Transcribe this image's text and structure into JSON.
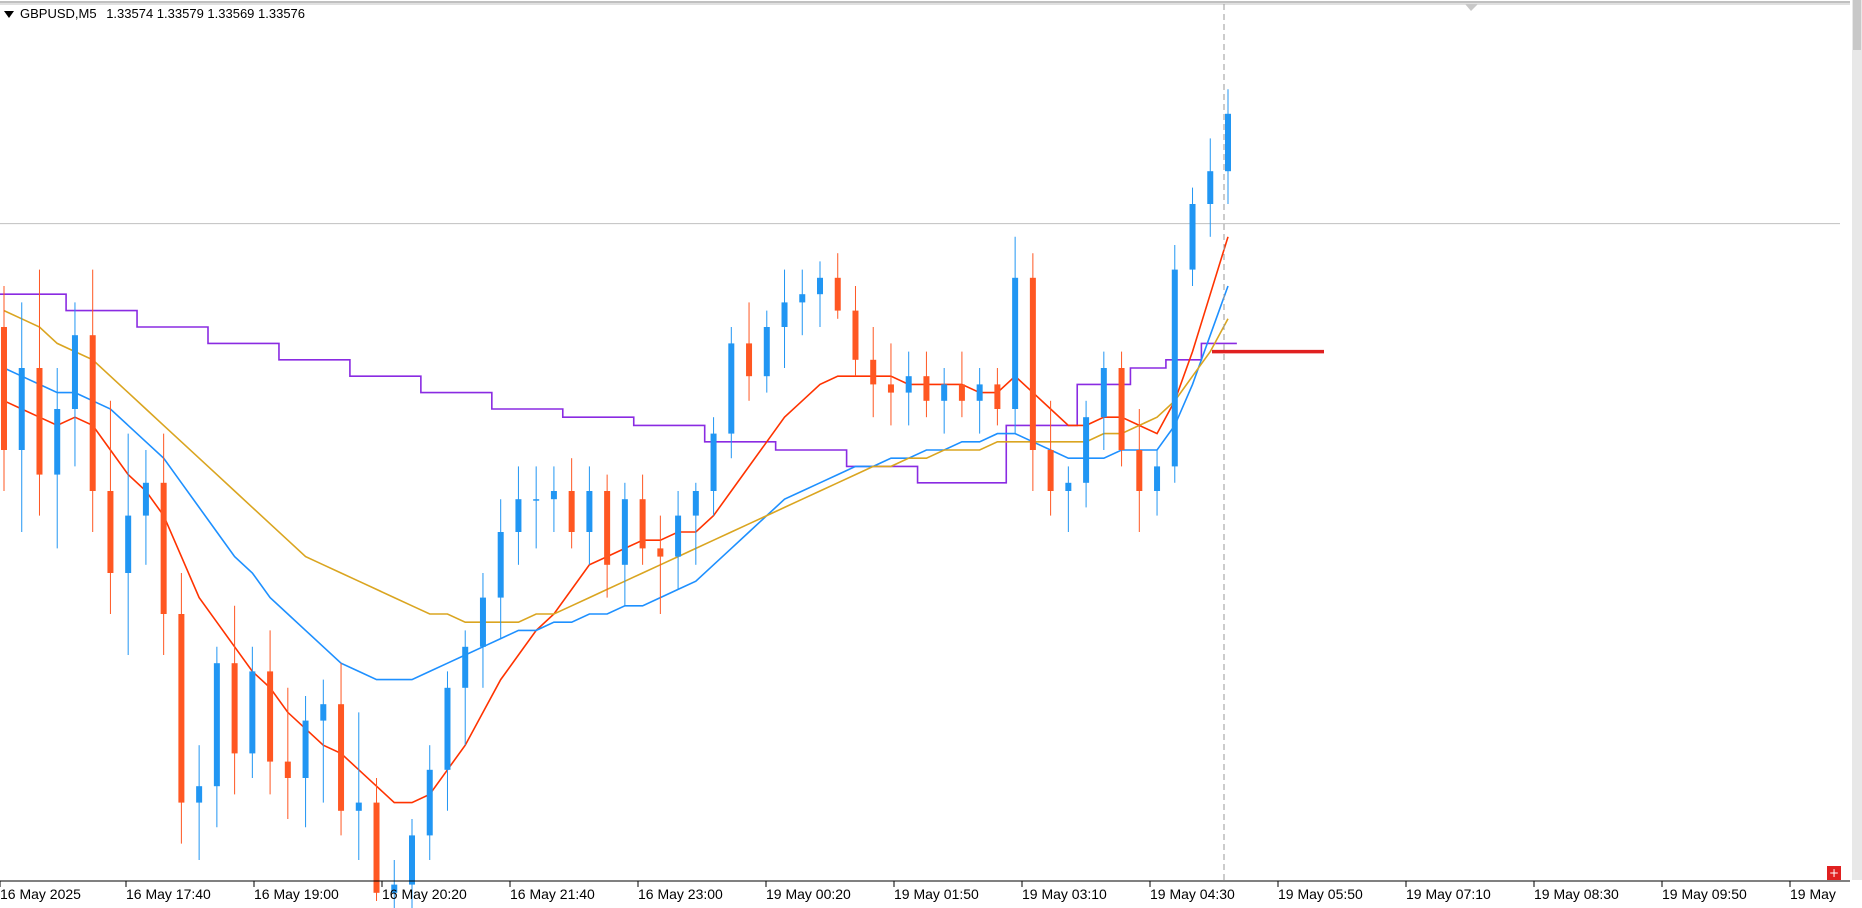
{
  "header": {
    "symbol": "GBPUSD,M5",
    "quotes": "1.33574 1.33579 1.33569 1.33576"
  },
  "colors": {
    "bull": "#2196f3",
    "bear": "#ff5722",
    "wick": "#000000",
    "ma_fast": "#ff3300",
    "ma_mid": "#1e90ff",
    "ma_slow": "#daa520",
    "stop_line": "#8a2be2",
    "level_marker": "#e02020",
    "grid": "#c0c0c0"
  },
  "icons": {
    "header_menu": "triangle-down-icon",
    "corner": "plus-icon",
    "top_marker": "chevron-down-icon"
  },
  "corner_button": "+",
  "chart_data": {
    "type": "candlestick",
    "symbol": "GBPUSD",
    "timeframe": "M5",
    "last_quote": {
      "open": 1.33574,
      "high": 1.33579,
      "low": 1.33569,
      "close": 1.33576
    },
    "x_labels": [
      "16 May 2025",
      "16 May 17:40",
      "16 May 19:00",
      "16 May 20:20",
      "16 May 21:40",
      "16 May 23:00",
      "19 May 00:20",
      "19 May 01:50",
      "19 May 03:10",
      "19 May 04:30",
      "19 May 05:50",
      "19 May 07:10",
      "19 May 08:30",
      "19 May 09:50",
      "19 May"
    ],
    "y_range": [
      1.328,
      1.338
    ],
    "current_price_line": 1.33576,
    "marked_level": 1.3342,
    "current_time_marker": "19 May 04:30",
    "series": [
      {
        "kind": "ohlc",
        "points": [
          [
            1.3345,
            1.335,
            1.3325,
            1.333
          ],
          [
            1.333,
            1.3348,
            1.332,
            1.334
          ],
          [
            1.334,
            1.3352,
            1.3322,
            1.3327
          ],
          [
            1.3327,
            1.334,
            1.3318,
            1.3335
          ],
          [
            1.3335,
            1.3348,
            1.3328,
            1.3344
          ],
          [
            1.3344,
            1.3352,
            1.332,
            1.3325
          ],
          [
            1.3325,
            1.3336,
            1.331,
            1.3315
          ],
          [
            1.3315,
            1.3332,
            1.3305,
            1.3322
          ],
          [
            1.3322,
            1.333,
            1.3316,
            1.3326
          ],
          [
            1.3326,
            1.3332,
            1.3305,
            1.331
          ],
          [
            1.331,
            1.3315,
            1.3282,
            1.3287
          ],
          [
            1.3287,
            1.3294,
            1.328,
            1.3289
          ],
          [
            1.3289,
            1.3306,
            1.3284,
            1.3304
          ],
          [
            1.3304,
            1.3311,
            1.3288,
            1.3293
          ],
          [
            1.3293,
            1.3306,
            1.329,
            1.3303
          ],
          [
            1.3303,
            1.3308,
            1.3288,
            1.3292
          ],
          [
            1.3292,
            1.3301,
            1.3285,
            1.329
          ],
          [
            1.329,
            1.33,
            1.3284,
            1.3297
          ],
          [
            1.3297,
            1.3302,
            1.3287,
            1.3299
          ],
          [
            1.3299,
            1.3304,
            1.3283,
            1.3286
          ],
          [
            1.3286,
            1.3298,
            1.328,
            1.3287
          ],
          [
            1.3287,
            1.329,
            1.3275,
            1.3276
          ],
          [
            1.3276,
            1.328,
            1.3272,
            1.3277
          ],
          [
            1.3277,
            1.3285,
            1.3272,
            1.3283
          ],
          [
            1.3283,
            1.3294,
            1.328,
            1.3291
          ],
          [
            1.3291,
            1.3303,
            1.3286,
            1.3301
          ],
          [
            1.3301,
            1.3308,
            1.3294,
            1.3306
          ],
          [
            1.3306,
            1.3315,
            1.3301,
            1.3312
          ],
          [
            1.3312,
            1.3324,
            1.3307,
            1.332
          ],
          [
            1.332,
            1.3328,
            1.3316,
            1.3324
          ],
          [
            1.3324,
            1.3328,
            1.3318,
            1.3324
          ],
          [
            1.3324,
            1.3328,
            1.332,
            1.3325
          ],
          [
            1.3325,
            1.3329,
            1.3318,
            1.332
          ],
          [
            1.332,
            1.3328,
            1.3316,
            1.3325
          ],
          [
            1.3325,
            1.3327,
            1.3312,
            1.3316
          ],
          [
            1.3316,
            1.3326,
            1.3311,
            1.3324
          ],
          [
            1.3324,
            1.3327,
            1.3316,
            1.3318
          ],
          [
            1.3318,
            1.3322,
            1.331,
            1.3317
          ],
          [
            1.3317,
            1.3325,
            1.3313,
            1.3322
          ],
          [
            1.3322,
            1.3326,
            1.3316,
            1.3325
          ],
          [
            1.3325,
            1.3334,
            1.3322,
            1.3332
          ],
          [
            1.3332,
            1.3345,
            1.3329,
            1.3343
          ],
          [
            1.3343,
            1.3348,
            1.3336,
            1.3339
          ],
          [
            1.3339,
            1.3347,
            1.3337,
            1.3345
          ],
          [
            1.3345,
            1.3352,
            1.334,
            1.3348
          ],
          [
            1.3348,
            1.3352,
            1.3344,
            1.3349
          ],
          [
            1.3349,
            1.3353,
            1.3345,
            1.3351
          ],
          [
            1.3351,
            1.3354,
            1.3346,
            1.3347
          ],
          [
            1.3347,
            1.335,
            1.3339,
            1.3341
          ],
          [
            1.3341,
            1.3345,
            1.3334,
            1.3338
          ],
          [
            1.3338,
            1.3343,
            1.3333,
            1.3337
          ],
          [
            1.3337,
            1.3342,
            1.3333,
            1.3339
          ],
          [
            1.3339,
            1.3342,
            1.3334,
            1.3336
          ],
          [
            1.3336,
            1.334,
            1.3332,
            1.3338
          ],
          [
            1.3338,
            1.3342,
            1.3334,
            1.3336
          ],
          [
            1.3336,
            1.334,
            1.3332,
            1.3338
          ],
          [
            1.3338,
            1.334,
            1.3333,
            1.3335
          ],
          [
            1.3335,
            1.3356,
            1.3332,
            1.3351
          ],
          [
            1.3351,
            1.3354,
            1.3325,
            1.333
          ],
          [
            1.333,
            1.3336,
            1.3322,
            1.3325
          ],
          [
            1.3325,
            1.3328,
            1.332,
            1.3326
          ],
          [
            1.3326,
            1.3336,
            1.3323,
            1.3334
          ],
          [
            1.3334,
            1.3342,
            1.333,
            1.334
          ],
          [
            1.334,
            1.3342,
            1.3328,
            1.333
          ],
          [
            1.333,
            1.3335,
            1.332,
            1.3325
          ],
          [
            1.3325,
            1.333,
            1.3322,
            1.3328
          ],
          [
            1.3328,
            1.3355,
            1.3326,
            1.3352
          ],
          [
            1.3352,
            1.3362,
            1.335,
            1.336
          ],
          [
            1.336,
            1.3368,
            1.3356,
            1.3364
          ],
          [
            1.3364,
            1.3374,
            1.336,
            1.3371
          ]
        ]
      },
      {
        "name": "",
        "kind": "ma",
        "color_key": "ma_fast"
      },
      {
        "name": "",
        "kind": "ma",
        "color_key": "ma_mid"
      },
      {
        "name": "",
        "kind": "ma",
        "color_key": "ma_slow"
      },
      {
        "name": "",
        "kind": "step",
        "color_key": "stop_line"
      }
    ],
    "ma_fast": [
      1.3336,
      1.3335,
      1.3334,
      1.3333,
      1.3334,
      1.3333,
      1.333,
      1.3327,
      1.3325,
      1.3322,
      1.3317,
      1.3312,
      1.3309,
      1.3306,
      1.3303,
      1.3301,
      1.3298,
      1.3296,
      1.3294,
      1.3293,
      1.3291,
      1.3289,
      1.3287,
      1.3287,
      1.3288,
      1.3291,
      1.3294,
      1.3298,
      1.3302,
      1.3305,
      1.3308,
      1.331,
      1.3313,
      1.3316,
      1.3317,
      1.3318,
      1.3319,
      1.3319,
      1.332,
      1.332,
      1.3322,
      1.3325,
      1.3328,
      1.3331,
      1.3334,
      1.3336,
      1.3338,
      1.3339,
      1.3339,
      1.3339,
      1.3339,
      1.3338,
      1.3338,
      1.3338,
      1.3338,
      1.3337,
      1.3337,
      1.3339,
      1.3337,
      1.3335,
      1.3333,
      1.3333,
      1.3334,
      1.3334,
      1.3333,
      1.3332,
      1.3336,
      1.3342,
      1.3349,
      1.3356
    ],
    "ma_mid": [
      1.334,
      1.3339,
      1.3338,
      1.3337,
      1.3337,
      1.3336,
      1.3335,
      1.3333,
      1.3331,
      1.3329,
      1.3326,
      1.3323,
      1.332,
      1.3317,
      1.3315,
      1.3312,
      1.331,
      1.3308,
      1.3306,
      1.3304,
      1.3303,
      1.3302,
      1.3302,
      1.3302,
      1.3303,
      1.3304,
      1.3305,
      1.3306,
      1.3307,
      1.3308,
      1.3308,
      1.3309,
      1.3309,
      1.331,
      1.331,
      1.3311,
      1.3311,
      1.3312,
      1.3313,
      1.3314,
      1.3316,
      1.3318,
      1.332,
      1.3322,
      1.3324,
      1.3325,
      1.3326,
      1.3327,
      1.3328,
      1.3328,
      1.3329,
      1.3329,
      1.333,
      1.333,
      1.3331,
      1.3331,
      1.3332,
      1.3332,
      1.3331,
      1.333,
      1.3329,
      1.3329,
      1.3329,
      1.333,
      1.333,
      1.333,
      1.3333,
      1.3338,
      1.3344,
      1.335
    ],
    "ma_slow": [
      1.3347,
      1.3346,
      1.3345,
      1.3343,
      1.3342,
      1.3341,
      1.3339,
      1.3337,
      1.3335,
      1.3333,
      1.3331,
      1.3329,
      1.3327,
      1.3325,
      1.3323,
      1.3321,
      1.3319,
      1.3317,
      1.3316,
      1.3315,
      1.3314,
      1.3313,
      1.3312,
      1.3311,
      1.331,
      1.331,
      1.3309,
      1.3309,
      1.3309,
      1.3309,
      1.331,
      1.331,
      1.3311,
      1.3312,
      1.3313,
      1.3314,
      1.3315,
      1.3316,
      1.3317,
      1.3318,
      1.3319,
      1.332,
      1.3321,
      1.3322,
      1.3323,
      1.3324,
      1.3325,
      1.3326,
      1.3327,
      1.3328,
      1.3328,
      1.3329,
      1.3329,
      1.333,
      1.333,
      1.333,
      1.3331,
      1.3331,
      1.3331,
      1.3331,
      1.3331,
      1.3331,
      1.3332,
      1.3332,
      1.3333,
      1.3334,
      1.3336,
      1.3339,
      1.3342,
      1.3346
    ],
    "stop_line": [
      1.3349,
      1.3349,
      1.3349,
      1.3349,
      1.3347,
      1.3347,
      1.3347,
      1.3347,
      1.3345,
      1.3345,
      1.3345,
      1.3345,
      1.3343,
      1.3343,
      1.3343,
      1.3343,
      1.3341,
      1.3341,
      1.3341,
      1.3341,
      1.3339,
      1.3339,
      1.3339,
      1.3339,
      1.3337,
      1.3337,
      1.3337,
      1.3337,
      1.3335,
      1.3335,
      1.3335,
      1.3335,
      1.3334,
      1.3334,
      1.3334,
      1.3334,
      1.3333,
      1.3333,
      1.3333,
      1.3333,
      1.3331,
      1.3331,
      1.3331,
      1.3331,
      1.333,
      1.333,
      1.333,
      1.333,
      1.3328,
      1.3328,
      1.3328,
      1.3328,
      1.3326,
      1.3326,
      1.3326,
      1.3326,
      1.3326,
      1.3333,
      1.3333,
      1.3333,
      1.3333,
      1.3338,
      1.3338,
      1.3338,
      1.334,
      1.334,
      1.3341,
      1.3341,
      1.3343,
      1.3343
    ]
  }
}
